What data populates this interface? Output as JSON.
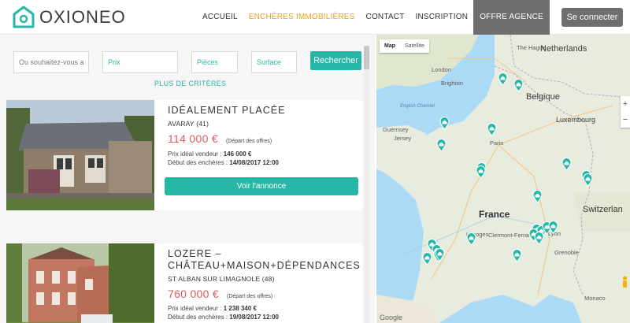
{
  "header": {
    "brand": "OXIONEO",
    "nav": [
      {
        "label": "ACCUEIL",
        "active": false,
        "dark": false
      },
      {
        "label": "ENCHÈRES IMMOBILIÈRES",
        "active": true,
        "dark": false
      },
      {
        "label": "CONTACT",
        "active": false,
        "dark": false
      },
      {
        "label": "INSCRIPTION",
        "active": false,
        "dark": false
      },
      {
        "label": "OFFRE AGENCE",
        "active": false,
        "dark": true
      }
    ],
    "connect_label": "Se connecter"
  },
  "search": {
    "location_placeholder": "Ou souhaitez-vous a",
    "price_placeholder": "Prix",
    "rooms_placeholder": "Pièces",
    "surface_placeholder": "Surface",
    "search_label": "Rechercher",
    "more_label": "PLUS DE CRITÈRES"
  },
  "listings": [
    {
      "title": "IDÉALEMENT PLACÉE",
      "town": "AVARAY (41)",
      "price": "114 000 €",
      "price_note": "(Départ des offres)",
      "seller_label": "Prix idéal vendeur :",
      "seller_value": "146 000 €",
      "start_label": "Début des enchères :",
      "start_value": "14/08/2017 12:00",
      "button_label": "Voir l'annonce"
    },
    {
      "title": "LOZERE – CHÂTEAU+MAISON+DÉPENDANCES",
      "town": "ST ALBAN SUR LIMAGNOLE (48)",
      "price": "760 000 €",
      "price_note": "(Départ des offres)",
      "seller_label": "Prix idéal vendeur :",
      "seller_value": "1 238 340 €",
      "start_label": "Début des enchères :",
      "start_value": "19/08/2017 12:00"
    }
  ],
  "map": {
    "tabs": [
      "Map",
      "Satellite"
    ],
    "labels": {
      "netherlands": "Netherlands",
      "belgium": "Belgique",
      "luxembourg": "Luxembourg",
      "france": "France",
      "switzerland": "Switzerlan",
      "guernsey": "Guernsey",
      "jersey": "Jersey",
      "paris": "Paris",
      "london": "London",
      "english_channel": "English Channel",
      "monaco": "Monaco",
      "limoges": "Limoges",
      "clermont": "Clermont-Ferrand",
      "grenoble": "Grenoble",
      "lyon": "Lyon",
      "the_hague": "The Hague",
      "brighton": "Brighton",
      "google": "Google"
    },
    "zoom_in": "+",
    "zoom_out": "−",
    "marker_color": "#26b7a6"
  }
}
